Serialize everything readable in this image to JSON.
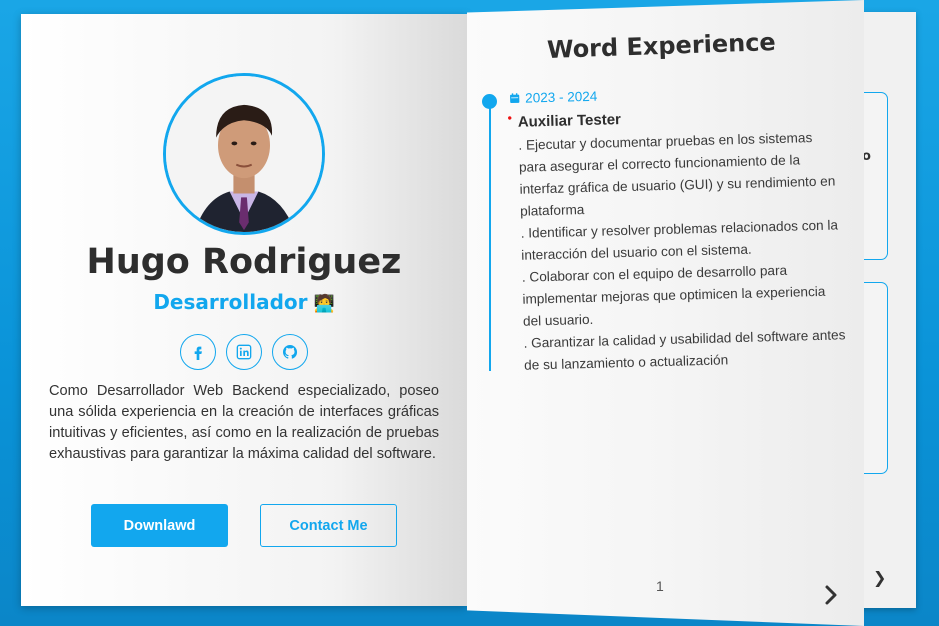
{
  "profile": {
    "name": "Hugo Rodriguez",
    "role": "Desarrollador",
    "role_emoji": "🧑‍💻",
    "bio": "Como Desarrollador Web Backend especializado, poseo una sólida experiencia en la creación de interfaces gráficas intuitivas y eficientes, así como en la realización de pruebas exhaustivas para garantizar la máxima calidad del software.",
    "socials": [
      {
        "icon": "facebook-icon"
      },
      {
        "icon": "linkedin-icon"
      },
      {
        "icon": "github-icon"
      }
    ]
  },
  "buttons": {
    "download_label": "Downlawd",
    "contact_label": "Contact Me"
  },
  "experience_page": {
    "title": "Word Experience",
    "items": [
      {
        "date": "2023 - 2024",
        "position": "Auxiliar Tester",
        "duties": [
          ". Ejecutar y documentar pruebas en los sistemas para asegurar el correcto funcionamiento de la interfaz gráfica de usuario (GUI) y su rendimiento en plataforma",
          ". Identificar y resolver problemas relacionados con la interacción del usuario con el sistema.",
          ". Colaborar con el equipo de desarrollo para implementar mejoras que optimicen la experiencia del usuario.",
          ". Garantizar la calidad y usabilidad del software antes de su lanzamiento o actualización"
        ]
      }
    ],
    "page_number": "1"
  },
  "back_page": {
    "peek_char": "o"
  },
  "colors": {
    "accent": "#12a7ee",
    "background": "#0a93d8",
    "heading": "#2e2e2e"
  }
}
